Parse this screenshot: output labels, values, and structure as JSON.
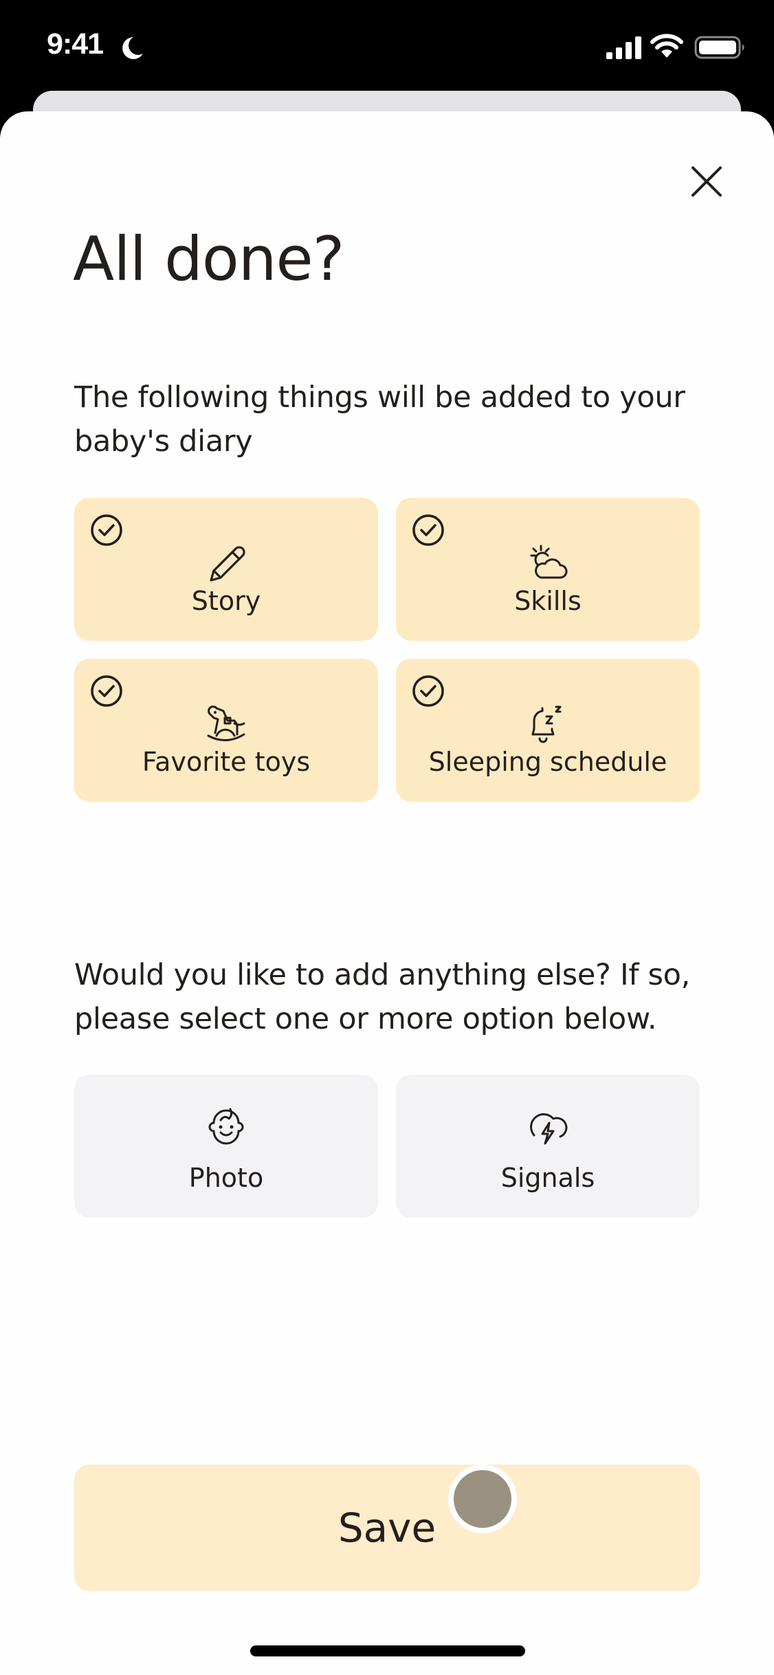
{
  "status_bar": {
    "time": "9:41",
    "icons": [
      "moon-icon",
      "signal-icon",
      "wifi-icon",
      "battery-icon"
    ]
  },
  "dialog": {
    "close_icon": "close-icon",
    "title": "All done?",
    "intro_text": "The following things will be added to your baby's diary",
    "selected_items": [
      {
        "label": "Story",
        "icon": "pencil-icon",
        "checked": true
      },
      {
        "label": "Skills",
        "icon": "sun-cloud-icon",
        "checked": true
      },
      {
        "label": "Favorite toys",
        "icon": "rocking-horse-icon",
        "checked": true
      },
      {
        "label": "Sleeping schedule",
        "icon": "bell-sleep-icon",
        "checked": true
      }
    ],
    "prompt_text": "Would you like to add anything else? If so, please select one or more option below.",
    "options": [
      {
        "label": "Photo",
        "icon": "baby-face-icon",
        "checked": false
      },
      {
        "label": "Signals",
        "icon": "cloud-lightning-icon",
        "checked": false
      }
    ],
    "save_label": "Save"
  },
  "colors": {
    "selected_card": "#feeac2",
    "option_card": "#f3f2f5",
    "save_button": "#feeccb",
    "text": "#231f1c",
    "touch_cursor": "#9a9181"
  }
}
